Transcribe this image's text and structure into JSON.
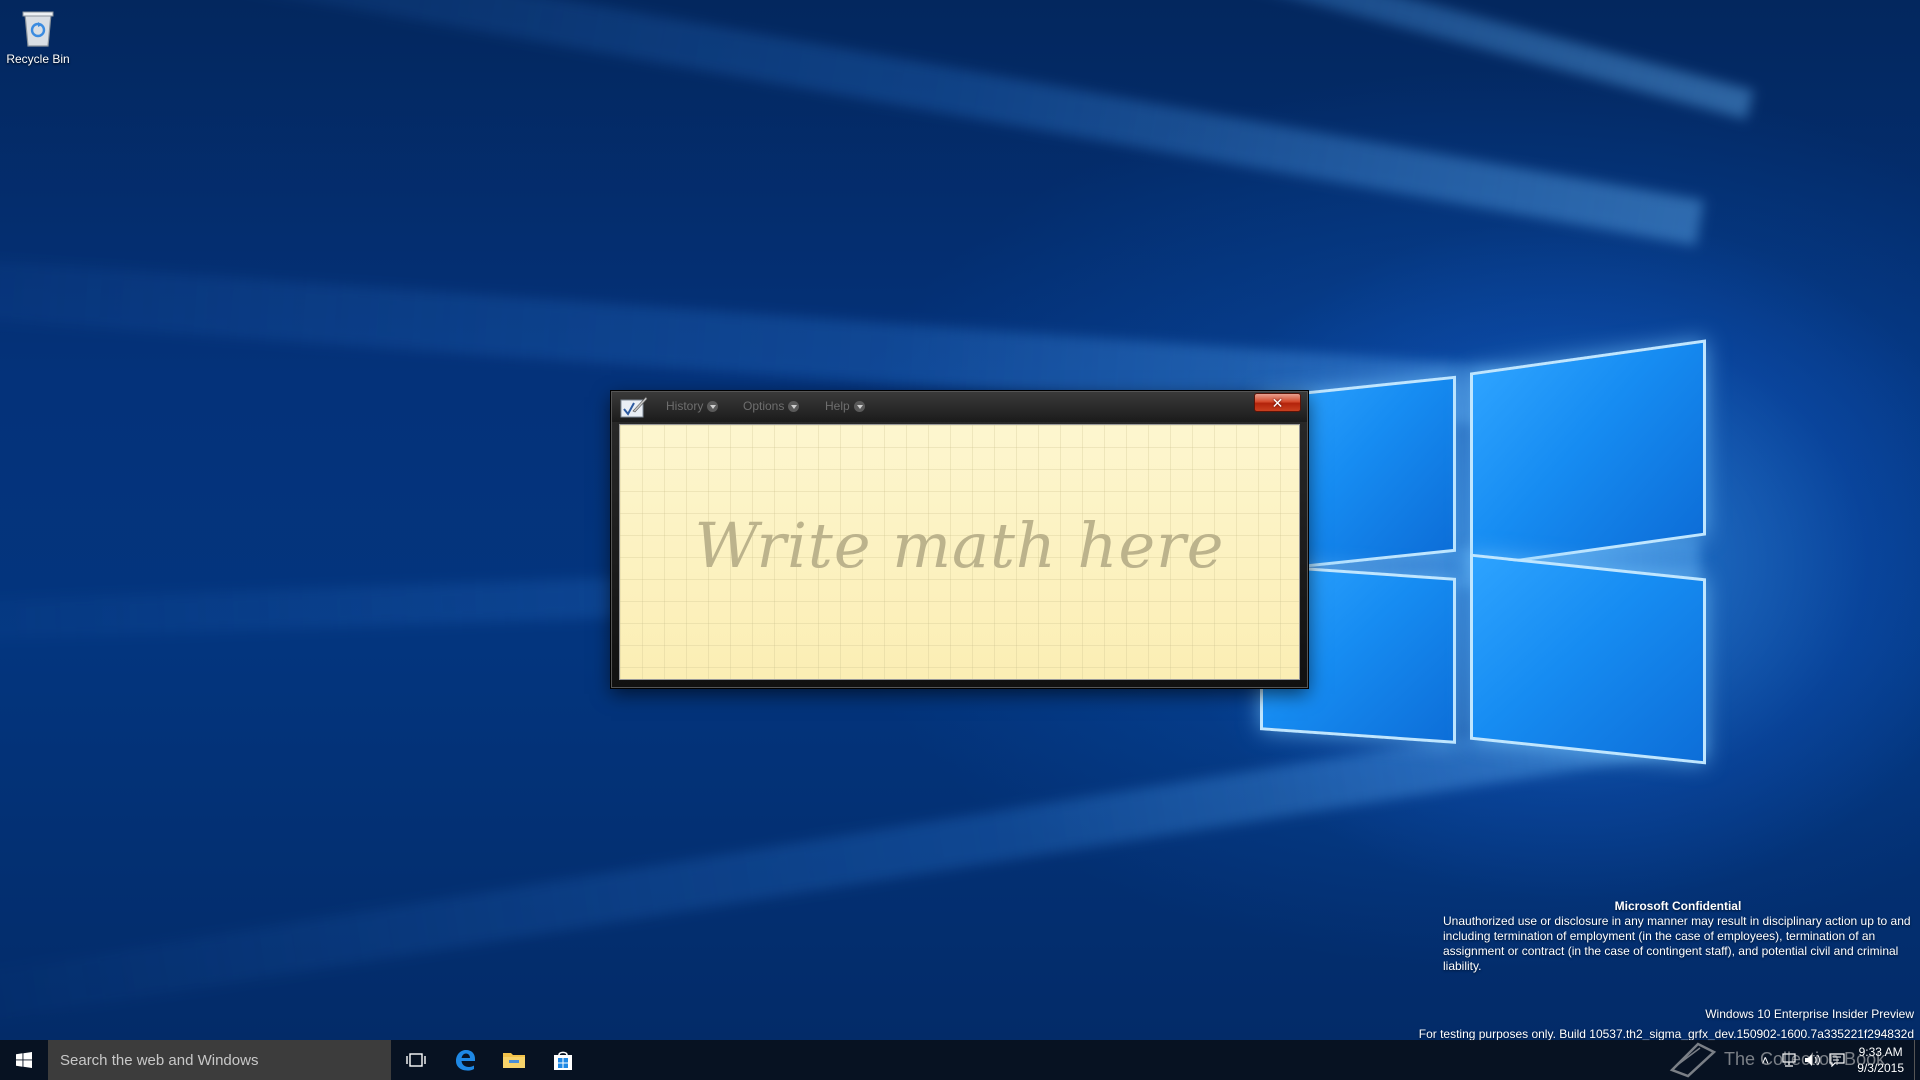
{
  "desktop": {
    "icons": [
      {
        "label": "Recycle Bin",
        "icon": "recycle-bin-icon"
      }
    ]
  },
  "math_window": {
    "menu": [
      {
        "label": "History",
        "icon": "chevron-down-icon"
      },
      {
        "label": "Options",
        "icon": "chevron-down-icon"
      },
      {
        "label": "Help",
        "icon": "chevron-down-icon"
      }
    ],
    "close_label": "✕",
    "pad_hint": "Write math here",
    "colors": {
      "pad_background": "#fdf3c0",
      "hint_text": "#bcb38c",
      "close_red": "#c9401f"
    }
  },
  "watermark": {
    "title": "Microsoft Confidential",
    "body": "Unauthorized use or disclosure in any manner may result in disciplinary action up to and including termination of employment (in the case of employees), termination of an assignment or contract (in the case of contingent staff), and potential civil and criminal liability.",
    "edition": "Windows 10 Enterprise Insider Preview",
    "build": "For testing purposes only. Build 10537.th2_sigma_grfx_dev.150902-1600.7a335221f294832d"
  },
  "brand_overlay": {
    "text": "The Collection Book"
  },
  "taskbar": {
    "search_placeholder": "Search the web and Windows",
    "pinned": [
      {
        "name": "task-view",
        "icon": "task-view-icon"
      },
      {
        "name": "edge",
        "icon": "edge-icon"
      },
      {
        "name": "file-explorer",
        "icon": "folder-icon"
      },
      {
        "name": "store",
        "icon": "store-icon"
      }
    ],
    "tray": {
      "time": "9:33 AM",
      "date": "9/3/2015"
    },
    "colors": {
      "accent_blue": "#1e88e5"
    }
  }
}
